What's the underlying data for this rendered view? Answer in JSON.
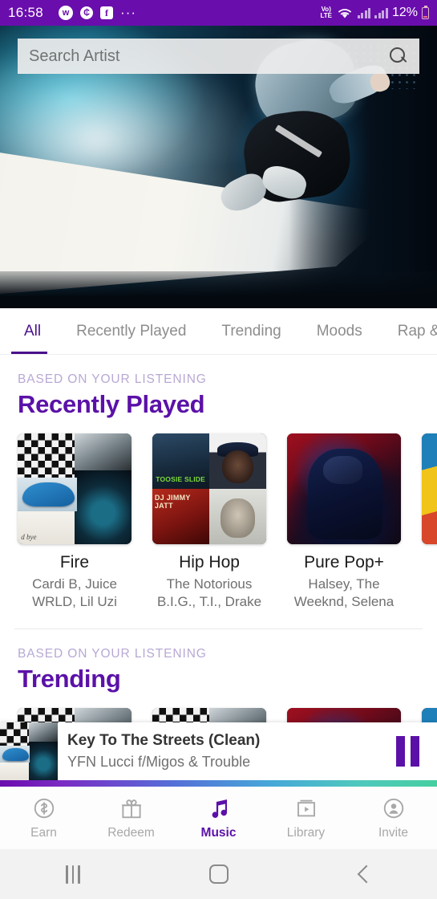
{
  "status_bar": {
    "time": "16:58",
    "left_icons": [
      {
        "name": "app-w-icon",
        "glyph": "w"
      },
      {
        "name": "coin-icon",
        "glyph": "₵"
      },
      {
        "name": "facebook-icon",
        "glyph": "f"
      },
      {
        "name": "more-notifications-icon",
        "glyph": "···"
      }
    ],
    "network_label": "Vo)\nLTE",
    "volte_line1": "Vo)",
    "volte_line2": "LTE",
    "battery_percent": "12%",
    "accent": "#6a0dad"
  },
  "search": {
    "placeholder": "Search Artist",
    "value": "",
    "icon": "search-icon"
  },
  "tabs": [
    {
      "label": "All",
      "active": true
    },
    {
      "label": "Recently Played",
      "active": false
    },
    {
      "label": "Trending",
      "active": false
    },
    {
      "label": "Moods",
      "active": false
    },
    {
      "label": "Rap &",
      "active": false
    }
  ],
  "sections": [
    {
      "eyebrow": "BASED ON YOUR LISTENING",
      "title": "Recently Played",
      "cards": [
        {
          "title": "Fire",
          "artists": "Cardi B, Juice WRLD, Lil Uzi"
        },
        {
          "title": "Hip Hop",
          "artists": "The Notorious B.I.G., T.I., Drake"
        },
        {
          "title": "Pure Pop+",
          "artists": "Halsey, The Weeknd, Selena"
        }
      ]
    },
    {
      "eyebrow": "BASED ON YOUR LISTENING",
      "title": "Trending",
      "cards": []
    }
  ],
  "now_playing": {
    "title": "Key To The Streets (Clean)",
    "artist": "YFN Lucci f/Migos & Trouble",
    "control": "pause",
    "accent": "#5b11a8"
  },
  "bottom_nav": [
    {
      "label": "Earn",
      "icon": "coin-icon",
      "active": false
    },
    {
      "label": "Redeem",
      "icon": "gift-icon",
      "active": false
    },
    {
      "label": "Music",
      "icon": "music-note-icon",
      "active": true
    },
    {
      "label": "Library",
      "icon": "video-library-icon",
      "active": false
    },
    {
      "label": "Invite",
      "icon": "person-add-icon",
      "active": false
    }
  ],
  "android_nav": [
    {
      "label": "recents",
      "icon": "recents-icon"
    },
    {
      "label": "home",
      "icon": "home-icon"
    },
    {
      "label": "back",
      "icon": "back-icon"
    }
  ],
  "colors": {
    "brand_purple": "#6a0dad",
    "title_purple": "#5b11a8",
    "tab_active": "#4a0f8a",
    "eyebrow": "#b8a8d4"
  }
}
